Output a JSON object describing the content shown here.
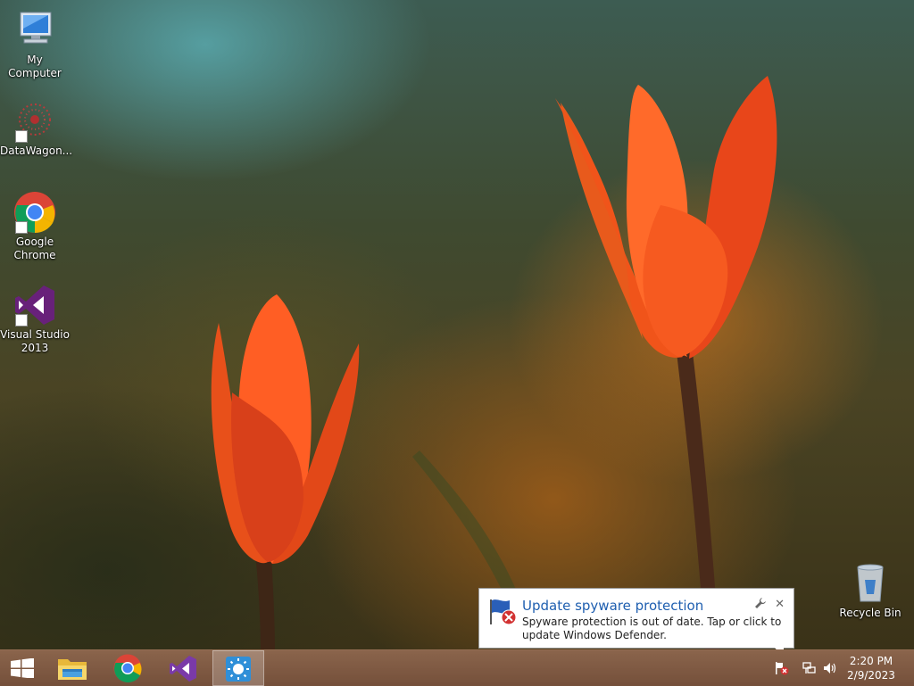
{
  "desktop": {
    "icons": [
      {
        "label": "My Computer",
        "icon": "computer-icon"
      },
      {
        "label": "DataWagon...",
        "icon": "datawagon-icon"
      },
      {
        "label": "Google Chrome",
        "icon": "chrome-icon"
      },
      {
        "label": "Visual Studio 2013",
        "icon": "visual-studio-icon"
      },
      {
        "label": "Recycle Bin",
        "icon": "recycle-bin-icon"
      }
    ]
  },
  "taskbar": {
    "pinned": [
      {
        "name": "start-button",
        "icon": "windows-logo-icon"
      },
      {
        "name": "file-explorer",
        "icon": "folder-icon"
      },
      {
        "name": "google-chrome",
        "icon": "chrome-icon"
      },
      {
        "name": "visual-studio",
        "icon": "visual-studio-icon"
      },
      {
        "name": "active-app",
        "icon": "sun-icon",
        "active": true
      }
    ],
    "clock": {
      "time": "2:20 PM",
      "date": "2/9/2023"
    }
  },
  "notification": {
    "title": "Update spyware protection",
    "body": "Spyware protection is out of date. Tap or click to update Windows Defender."
  },
  "colors": {
    "taskbar": "#7a5238",
    "notification_title": "#1f5fb0",
    "vs_purple": "#68217a"
  }
}
